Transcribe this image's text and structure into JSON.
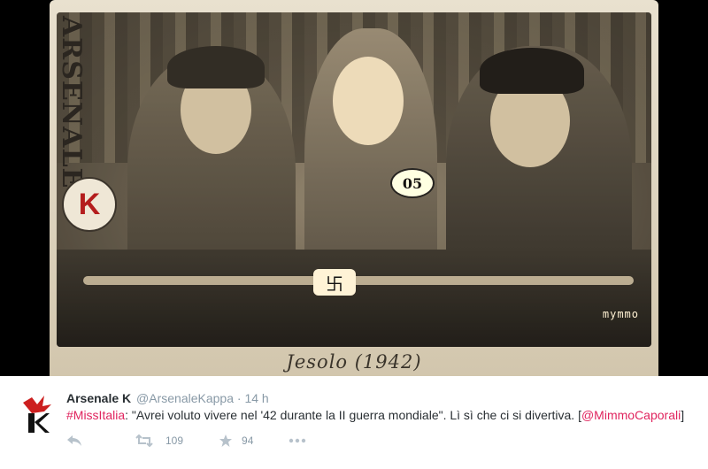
{
  "media": {
    "logo_text": "ARSENALE",
    "logo_letter": "K",
    "badge_number": "05",
    "watermark": "mymmo",
    "caption": "Jesolo (1942)"
  },
  "tweet": {
    "display_name": "Arsenale K",
    "handle": "@ArsenaleKappa",
    "separator": "·",
    "time": "14 h",
    "hashtag": "#MissItalia",
    "body": ": \"Avrei voluto vivere nel '42 durante la II guerra mondiale\". Lì sì che ci si divertiva. [",
    "mention": "@MimmoCaporali",
    "body_end": "]",
    "retweet_count": "109",
    "favorite_count": "94",
    "link_color": "#e0245e",
    "avatar_color": "#cc1f1f"
  }
}
